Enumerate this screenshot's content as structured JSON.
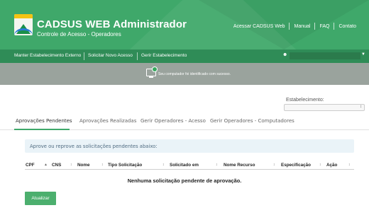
{
  "header": {
    "title": "CADSUS WEB Administrador",
    "subtitle": "Controle de Acesso - Operadores",
    "links": [
      "Acessar CADSUS Web",
      "Manual",
      "FAQ",
      "Contato"
    ],
    "colors": {
      "header_bg": "#3fa86a",
      "nav_bg": "#2f8c57",
      "band_bg": "#9aa39d",
      "accent": "#4caf6e"
    }
  },
  "nav": {
    "items": [
      "Manter Estabelecimento Externo",
      "Solicitar Novo Acesso",
      "Gerir Estabelecimento"
    ],
    "user_icon": "user-icon"
  },
  "info_band": {
    "icon": "monitor-check-icon",
    "message": "Seu computador foi identificado com sucesso."
  },
  "establishment": {
    "label": "Estabelecimento:",
    "selected": ""
  },
  "tabs": [
    "Aprovações Pendentes",
    "Aprovações Realizadas",
    "Gerir Operadores - Acesso",
    "Gerir Operadores - Computadores"
  ],
  "active_tab": "Aprovações Pendentes",
  "alert": "Aprove ou reprove as solicitações pendentes abaixo:",
  "table": {
    "columns": [
      "CPF",
      "CNS",
      "Nome",
      "Tipo Solicitação",
      "Solicitado em",
      "Nome Recurso",
      "Especificação",
      "Ação"
    ],
    "sorted_column": "CPF",
    "empty_message": "Nenhuma solicitação pendente de aprovação."
  },
  "buttons": {
    "refresh": "Atualizar"
  }
}
